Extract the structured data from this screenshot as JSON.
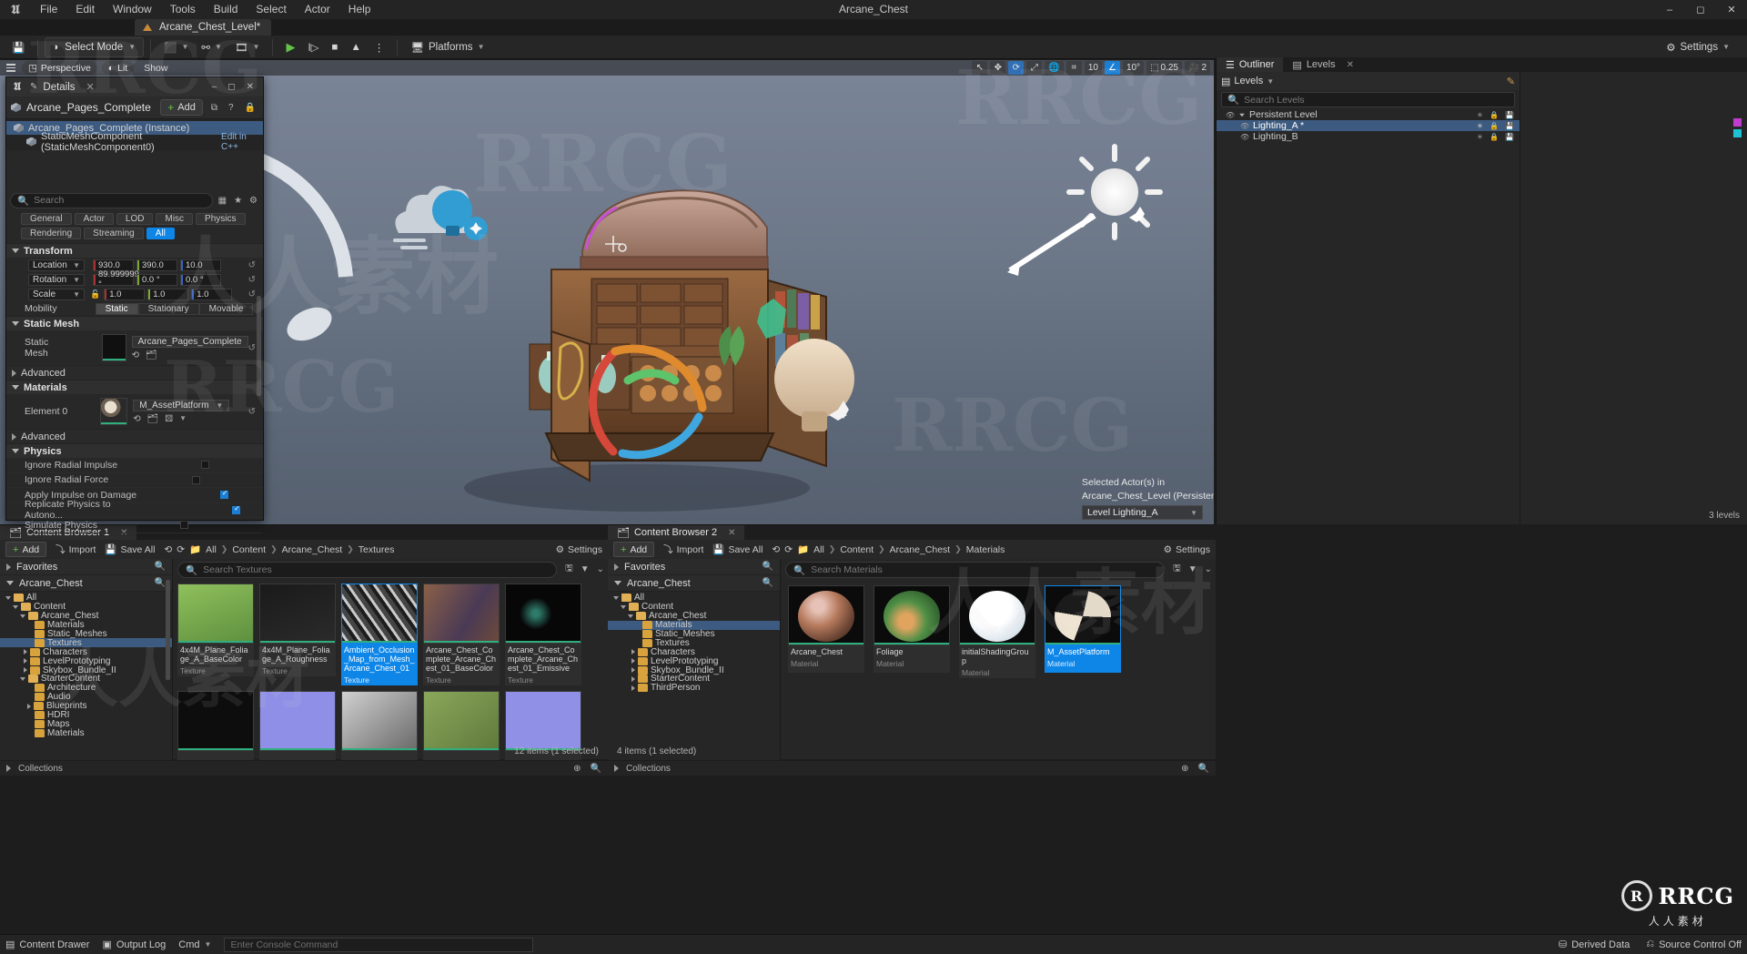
{
  "window": {
    "title": "Arcane_Chest",
    "minimize": "–",
    "maximize": "◻",
    "close": "✕"
  },
  "menu": {
    "items": [
      "File",
      "Edit",
      "Window",
      "Tools",
      "Build",
      "Select",
      "Actor",
      "Help"
    ]
  },
  "level_tab": {
    "label": "Arcane_Chest_Level*"
  },
  "toolbar": {
    "save_icon": "save-icon",
    "mode_label": "Select Mode",
    "create_icon": "add-actor-icon",
    "blueprint_icon": "blueprints-icon",
    "cinematics_icon": "cinematics-icon",
    "play_label": "▶",
    "skip_label": "I▷",
    "stop_label": "■",
    "eject_label": "▲",
    "more_label": "⋮",
    "platforms_label": "Platforms",
    "settings_label": "Settings"
  },
  "viewport": {
    "perspective": "Perspective",
    "lit": "Lit",
    "show": "Show",
    "right_controls": {
      "select_icon": "cursor-icon",
      "move_icon": "move-gizmo-icon",
      "rotate_icon": "rotate-gizmo-icon",
      "scale_icon": "scale-gizmo-icon",
      "world_icon": "world-space-icon",
      "snap_icon": "surface-snap-icon",
      "grid_value": "10",
      "angle_icon": "angle-snap-icon",
      "angle_value": "10°",
      "scale_value": "0.25",
      "camera_value": "2"
    },
    "selection_note_line1": "Selected Actor(s) in",
    "selection_note_line2": "Arcane_Chest_Level (Persistent)",
    "level_dropdown": "Level  Lighting_A"
  },
  "details": {
    "tab_title": "Details",
    "close": "✕",
    "actor_name": "Arcane_Pages_Complete",
    "add_label": "Add",
    "tree": [
      {
        "label": "Arcane_Pages_Complete (Instance)",
        "selected": true
      },
      {
        "label": "StaticMeshComponent (StaticMeshComponent0)",
        "selected": false,
        "extra": "Edit in C++"
      }
    ],
    "search_placeholder": "Search",
    "filters": [
      "General",
      "Actor",
      "LOD",
      "Misc",
      "Physics",
      "Rendering",
      "Streaming",
      "All"
    ],
    "active_filter": "All",
    "sections": {
      "transform": "Transform",
      "static_mesh": "Static Mesh",
      "advanced": "Advanced",
      "materials": "Materials",
      "physics": "Physics"
    },
    "transform": {
      "location": {
        "label": "Location",
        "x": "930.0",
        "y": "390.0",
        "z": "10.0"
      },
      "rotation": {
        "label": "Rotation",
        "x": "89.999999 °",
        "y": "0.0 °",
        "z": "0.0 °"
      },
      "scale": {
        "label": "Scale",
        "x": "1.0",
        "y": "1.0",
        "z": "1.0"
      },
      "mobility_label": "Mobility",
      "mobility_options": [
        "Static",
        "Stationary",
        "Movable"
      ],
      "mobility_active": "Static"
    },
    "static_mesh": {
      "label": "Static Mesh",
      "value": "Arcane_Pages_Complete"
    },
    "materials": {
      "label": "Element 0",
      "value": "M_AssetPlatform"
    },
    "physics_rows": [
      {
        "label": "Ignore Radial Impulse",
        "checked": false
      },
      {
        "label": "Ignore Radial Force",
        "checked": false
      },
      {
        "label": "Apply Impulse on Damage",
        "checked": true
      },
      {
        "label": "Replicate Physics to Autono...",
        "checked": true
      },
      {
        "label": "Simulate Physics",
        "checked": false
      }
    ]
  },
  "outliner": {
    "tabs": [
      {
        "label": "Outliner",
        "active": true
      },
      {
        "label": "Levels",
        "active": false
      }
    ],
    "close": "✕",
    "search_placeholder": "Search Levels",
    "levels_label": "Levels",
    "edit_icon": "pencil-icon",
    "rows": [
      {
        "label": "Persistent Level",
        "indent": 0,
        "selected": false
      },
      {
        "label": "Lighting_A *",
        "indent": 1,
        "selected": true,
        "color": "#c03bd0"
      },
      {
        "label": "Lighting_B",
        "indent": 1,
        "selected": false,
        "color": "#1fbfd4"
      }
    ],
    "footer": "3 levels"
  },
  "content_browser_1": {
    "tab_label": "Content Browser 1",
    "close": "✕",
    "add_label": "Add",
    "import_label": "Import",
    "save_all_label": "Save All",
    "breadcrumbs": [
      "All",
      "Content",
      "Arcane_Chest",
      "Textures"
    ],
    "settings_label": "Settings",
    "favorites_label": "Favorites",
    "root_label": "Arcane_Chest",
    "search_placeholder": "Search Textures",
    "tree": [
      {
        "label": "All",
        "depth": 0,
        "arrow": "down",
        "selected": false
      },
      {
        "label": "Content",
        "depth": 1,
        "arrow": "down",
        "selected": false
      },
      {
        "label": "Arcane_Chest",
        "depth": 2,
        "arrow": "down",
        "selected": false
      },
      {
        "label": "Materials",
        "depth": 3,
        "arrow": "none",
        "selected": false
      },
      {
        "label": "Static_Meshes",
        "depth": 3,
        "arrow": "none",
        "selected": false
      },
      {
        "label": "Textures",
        "depth": 3,
        "arrow": "none",
        "selected": true
      },
      {
        "label": "Characters",
        "depth": 2,
        "arrow": "right",
        "selected": false
      },
      {
        "label": "LevelPrototyping",
        "depth": 2,
        "arrow": "right",
        "selected": false
      },
      {
        "label": "Skybox_Bundle_II",
        "depth": 2,
        "arrow": "right",
        "selected": false
      },
      {
        "label": "StarterContent",
        "depth": 2,
        "arrow": "down",
        "selected": false
      },
      {
        "label": "Architecture",
        "depth": 3,
        "arrow": "none",
        "selected": false
      },
      {
        "label": "Audio",
        "depth": 3,
        "arrow": "none",
        "selected": false
      },
      {
        "label": "Blueprints",
        "depth": 3,
        "arrow": "right",
        "selected": false
      },
      {
        "label": "HDRI",
        "depth": 3,
        "arrow": "none",
        "selected": false
      },
      {
        "label": "Maps",
        "depth": 3,
        "arrow": "none",
        "selected": false
      },
      {
        "label": "Materials",
        "depth": 3,
        "arrow": "none",
        "selected": false
      }
    ],
    "assets": [
      {
        "name": "4x4M_Plane_Foliage_A_BaseColor",
        "type": "Texture",
        "selected": false,
        "thumb": "foliage-green"
      },
      {
        "name": "4x4M_Plane_Foliage_A_Roughness",
        "type": "Texture",
        "selected": false,
        "thumb": "foliage-gray"
      },
      {
        "name": "Ambient_Occlusion_Map_from_Mesh_Arcane_Chest_01",
        "type": "Texture",
        "selected": true,
        "thumb": "ao-map"
      },
      {
        "name": "Arcane_Chest_Complete_Arcane_Chest_01_BaseColor",
        "type": "Texture",
        "selected": false,
        "thumb": "basecolor"
      },
      {
        "name": "Arcane_Chest_Complete_Arcane_Chest_01_Emissive",
        "type": "Texture",
        "selected": false,
        "thumb": "emissive"
      },
      {
        "name": "",
        "type": "",
        "selected": false,
        "thumb": "dark-noise"
      },
      {
        "name": "",
        "type": "",
        "selected": false,
        "thumb": "normal-purple"
      },
      {
        "name": "",
        "type": "",
        "selected": false,
        "thumb": "gray-detail"
      },
      {
        "name": "",
        "type": "",
        "selected": false,
        "thumb": "green-mask"
      },
      {
        "name": "",
        "type": "",
        "selected": false,
        "thumb": "normal-purple2"
      }
    ],
    "collections_label": "Collections",
    "status": "12 items (1 selected)"
  },
  "content_browser_2": {
    "tab_label": "Content Browser 2",
    "close": "✕",
    "add_label": "Add",
    "import_label": "Import",
    "save_all_label": "Save All",
    "breadcrumbs": [
      "All",
      "Content",
      "Arcane_Chest",
      "Materials"
    ],
    "settings_label": "Settings",
    "favorites_label": "Favorites",
    "root_label": "Arcane_Chest",
    "search_placeholder": "Search Materials",
    "tree": [
      {
        "label": "All",
        "depth": 0,
        "arrow": "down",
        "selected": false
      },
      {
        "label": "Content",
        "depth": 1,
        "arrow": "down",
        "selected": false
      },
      {
        "label": "Arcane_Chest",
        "depth": 2,
        "arrow": "down",
        "selected": false
      },
      {
        "label": "Materials",
        "depth": 3,
        "arrow": "none",
        "selected": true
      },
      {
        "label": "Static_Meshes",
        "depth": 3,
        "arrow": "none",
        "selected": false
      },
      {
        "label": "Textures",
        "depth": 3,
        "arrow": "none",
        "selected": false
      },
      {
        "label": "Characters",
        "depth": 2,
        "arrow": "right",
        "selected": false
      },
      {
        "label": "LevelPrototyping",
        "depth": 2,
        "arrow": "right",
        "selected": false
      },
      {
        "label": "Skybox_Bundle_II",
        "depth": 2,
        "arrow": "right",
        "selected": false
      },
      {
        "label": "StarterContent",
        "depth": 2,
        "arrow": "right",
        "selected": false
      },
      {
        "label": "ThirdPerson",
        "depth": 2,
        "arrow": "right",
        "selected": false
      }
    ],
    "assets": [
      {
        "name": "Arcane_Chest",
        "type": "Material",
        "selected": false,
        "thumb": "chest-sphere"
      },
      {
        "name": "Foliage",
        "type": "Material",
        "selected": false,
        "thumb": "foliage-sphere"
      },
      {
        "name": "initialShadingGroup",
        "type": "Material",
        "selected": false,
        "thumb": "white-sphere"
      },
      {
        "name": "M_AssetPlatform",
        "type": "Material",
        "selected": true,
        "thumb": "platform-sphere"
      }
    ],
    "collections_label": "Collections",
    "status": "4 items (1 selected)"
  },
  "statusbar": {
    "content_drawer": "Content Drawer",
    "output_log": "Output Log",
    "cmd_label": "Cmd",
    "console_placeholder": "Enter Console Command",
    "derived_data": "Derived Data",
    "source_control": "Source Control Off"
  },
  "watermark": {
    "big": "RRCG",
    "cn": "人人素材",
    "brand": "RRCG",
    "brand_sub": "人人素材"
  },
  "colors": {
    "accent": "#0e86e8",
    "green": "#63c247",
    "sel_row": "#3d5b80",
    "panel": "#262626"
  }
}
